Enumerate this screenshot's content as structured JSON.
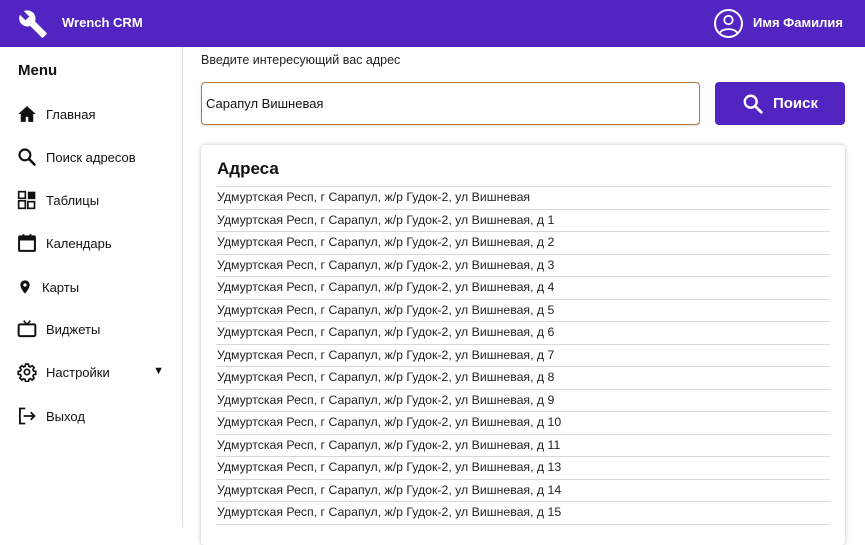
{
  "header": {
    "app_title": "Wrench CRM",
    "logo_icon": "wrench-icon",
    "user_icon": "user-avatar-icon",
    "user_name": "Имя Фамилия",
    "background": "#5225c2"
  },
  "sidebar": {
    "menu_title": "Menu",
    "items": [
      {
        "label": "Главная",
        "icon": "home-icon"
      },
      {
        "label": "Поиск адресов",
        "icon": "search-icon"
      },
      {
        "label": "Таблицы",
        "icon": "tables-icon"
      },
      {
        "label": "Календарь",
        "icon": "calendar-icon"
      },
      {
        "label": "Карты",
        "icon": "map-pin-icon"
      },
      {
        "label": "Виджеты",
        "icon": "tv-icon"
      },
      {
        "label": "Настройки",
        "icon": "gear-icon",
        "caret": "▼"
      },
      {
        "label": "Выход",
        "icon": "logout-icon"
      }
    ]
  },
  "search": {
    "prompt": "Введите интересующий вас адрес",
    "value": "Сарапул Вишневая",
    "button_label": "Поиск",
    "accent": "#5225c2",
    "input_border": "#b87842"
  },
  "results": {
    "title": "Адреса",
    "items": [
      "Удмуртская Респ, г Сарапул, ж/р Гудок-2, ул Вишневая",
      "Удмуртская Респ, г Сарапул, ж/р Гудок-2, ул Вишневая, д 1",
      "Удмуртская Респ, г Сарапул, ж/р Гудок-2, ул Вишневая, д 2",
      "Удмуртская Респ, г Сарапул, ж/р Гудок-2, ул Вишневая, д 3",
      "Удмуртская Респ, г Сарапул, ж/р Гудок-2, ул Вишневая, д 4",
      "Удмуртская Респ, г Сарапул, ж/р Гудок-2, ул Вишневая, д 5",
      "Удмуртская Респ, г Сарапул, ж/р Гудок-2, ул Вишневая, д 6",
      "Удмуртская Респ, г Сарапул, ж/р Гудок-2, ул Вишневая, д 7",
      "Удмуртская Респ, г Сарапул, ж/р Гудок-2, ул Вишневая, д 8",
      "Удмуртская Респ, г Сарапул, ж/р Гудок-2, ул Вишневая, д 9",
      "Удмуртская Респ, г Сарапул, ж/р Гудок-2, ул Вишневая, д 10",
      "Удмуртская Респ, г Сарапул, ж/р Гудок-2, ул Вишневая, д 11",
      "Удмуртская Респ, г Сарапул, ж/р Гудок-2, ул Вишневая, д 13",
      "Удмуртская Респ, г Сарапул, ж/р Гудок-2, ул Вишневая, д 14",
      "Удмуртская Респ, г Сарапул, ж/р Гудок-2, ул Вишневая, д 15"
    ]
  }
}
